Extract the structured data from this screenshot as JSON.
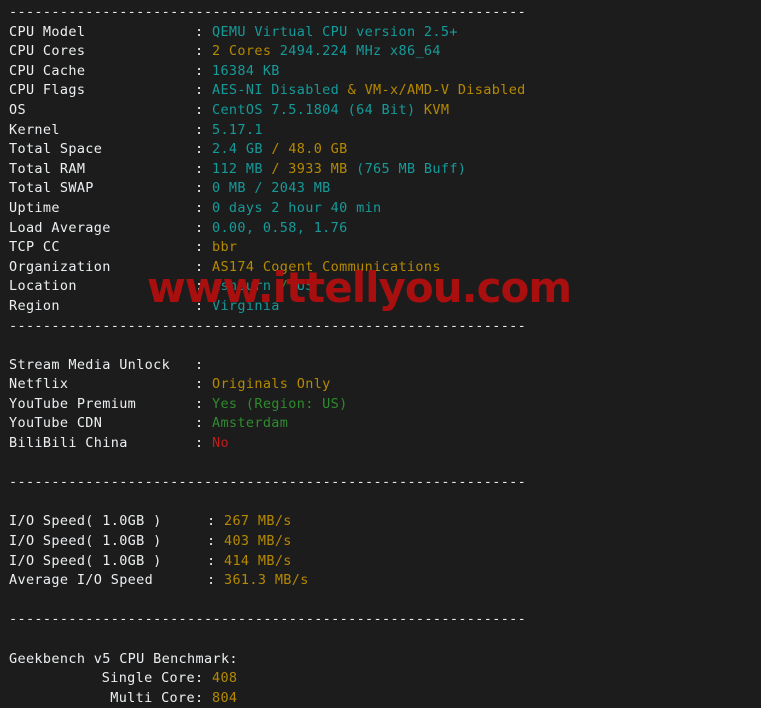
{
  "terminal": {
    "background": "#1c1c1c",
    "separator_line": "-------------------------------------------------------------",
    "colon": ":",
    "colors": {
      "label": "#eceff1",
      "teal": "#169a9a",
      "yellow": "#b58900",
      "green": "#2e8b2e",
      "red": "#c01c1c",
      "watermark": "#aa0f0f"
    }
  },
  "watermark": {
    "text": "www.ittellyou.com"
  },
  "sections": {
    "system": [
      {
        "label": "CPU Model",
        "parts": [
          {
            "text": "QEMU Virtual CPU version 2.5+",
            "color": "teal"
          }
        ]
      },
      {
        "label": "CPU Cores",
        "parts": [
          {
            "text": "2 Cores ",
            "color": "yellow"
          },
          {
            "text": "2494.224 MHz x86_64",
            "color": "teal"
          }
        ]
      },
      {
        "label": "CPU Cache",
        "parts": [
          {
            "text": "16384 KB",
            "color": "teal"
          }
        ]
      },
      {
        "label": "CPU Flags",
        "parts": [
          {
            "text": "AES-NI Disabled ",
            "color": "teal"
          },
          {
            "text": "& VM-x/AMD-V Disabled",
            "color": "yellow"
          }
        ]
      },
      {
        "label": "OS",
        "parts": [
          {
            "text": "CentOS 7.5.1804 (64 Bit) ",
            "color": "teal"
          },
          {
            "text": "KVM",
            "color": "yellow"
          }
        ]
      },
      {
        "label": "Kernel",
        "parts": [
          {
            "text": "5.17.1",
            "color": "teal"
          }
        ]
      },
      {
        "label": "Total Space",
        "parts": [
          {
            "text": "2.4 GB ",
            "color": "teal"
          },
          {
            "text": "/ 48.0 GB",
            "color": "yellow"
          }
        ]
      },
      {
        "label": "Total RAM",
        "parts": [
          {
            "text": "112 MB ",
            "color": "teal"
          },
          {
            "text": "/ 3933 MB ",
            "color": "yellow"
          },
          {
            "text": "(765 MB Buff)",
            "color": "teal"
          }
        ]
      },
      {
        "label": "Total SWAP",
        "parts": [
          {
            "text": "0 MB / 2043 MB",
            "color": "teal"
          }
        ]
      },
      {
        "label": "Uptime",
        "parts": [
          {
            "text": "0 days 2 hour 40 min",
            "color": "teal"
          }
        ]
      },
      {
        "label": "Load Average",
        "parts": [
          {
            "text": "0.00, 0.58, 1.76",
            "color": "teal"
          }
        ]
      },
      {
        "label": "TCP CC",
        "parts": [
          {
            "text": "bbr",
            "color": "yellow"
          }
        ]
      },
      {
        "label": "Organization",
        "parts": [
          {
            "text": "AS174 Cogent Communications",
            "color": "yellow"
          }
        ]
      },
      {
        "label": "Location",
        "parts": [
          {
            "text": "Ashburn ",
            "color": "teal"
          },
          {
            "text": "/ ",
            "color": "green"
          },
          {
            "text": "US",
            "color": "teal"
          }
        ]
      },
      {
        "label": "Region",
        "parts": [
          {
            "text": "Virginia",
            "color": "teal"
          }
        ]
      }
    ],
    "stream_media": [
      {
        "label": "Stream Media Unlock",
        "parts": []
      },
      {
        "label": "Netflix",
        "parts": [
          {
            "text": "Originals Only",
            "color": "yellow"
          }
        ]
      },
      {
        "label": "YouTube Premium",
        "parts": [
          {
            "text": "Yes (Region: US)",
            "color": "green"
          }
        ]
      },
      {
        "label": "YouTube CDN",
        "parts": [
          {
            "text": "Amsterdam",
            "color": "green"
          }
        ]
      },
      {
        "label": "BiliBili China",
        "parts": [
          {
            "text": "No",
            "color": "red"
          }
        ]
      }
    ],
    "io_speed": [
      {
        "label": "I/O Speed( 1.0GB )",
        "parts": [
          {
            "text": "267 MB/s",
            "color": "yellow"
          }
        ]
      },
      {
        "label": "I/O Speed( 1.0GB )",
        "parts": [
          {
            "text": "403 MB/s",
            "color": "yellow"
          }
        ]
      },
      {
        "label": "I/O Speed( 1.0GB )",
        "parts": [
          {
            "text": "414 MB/s",
            "color": "yellow"
          }
        ]
      },
      {
        "label": "Average I/O Speed",
        "parts": [
          {
            "text": "361.3 MB/s",
            "color": "yellow"
          }
        ]
      }
    ],
    "geekbench": {
      "title": "Geekbench v5 CPU Benchmark:",
      "rows": [
        {
          "label": "Single Core",
          "parts": [
            {
              "text": "408",
              "color": "yellow"
            }
          ]
        },
        {
          "label": "Multi Core",
          "parts": [
            {
              "text": "804",
              "color": "yellow"
            }
          ]
        }
      ]
    }
  }
}
